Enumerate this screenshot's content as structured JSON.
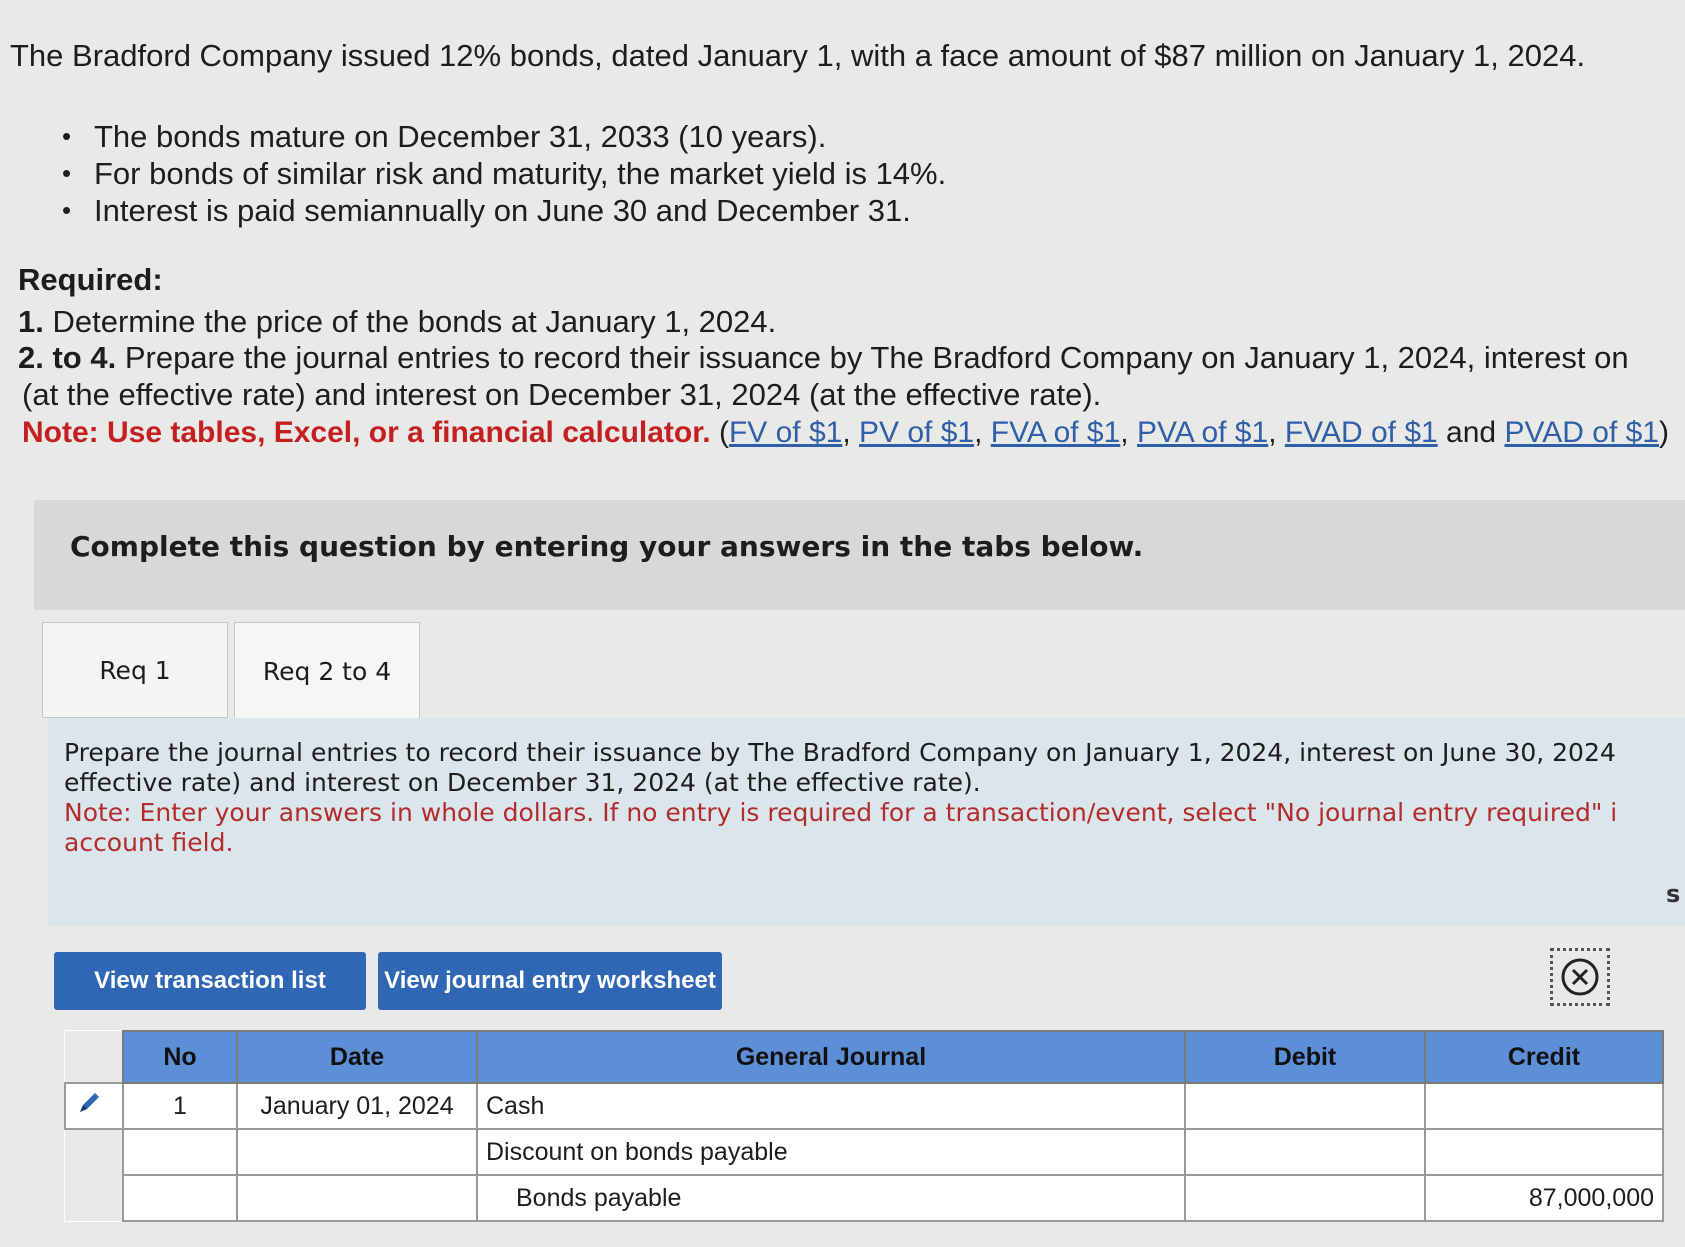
{
  "problem": {
    "intro": "The Bradford Company issued 12% bonds, dated January 1, with a face amount of $87 million on January 1, 2024.",
    "bullets": [
      "The bonds mature on December 31, 2033 (10 years).",
      "For bonds of similar risk and maturity, the market yield is 14%.",
      "Interest is paid semiannually on June 30 and December 31."
    ],
    "required_label": "Required:",
    "req1_num": "1.",
    "req1_text": "Determine the price of the bonds at January 1, 2024.",
    "req2_num": "2. to 4.",
    "req2_text": "Prepare the journal entries to record their issuance by The Bradford Company on January 1, 2024, interest on",
    "req2_cont": "(at the effective rate) and interest on December 31, 2024 (at the effective rate).",
    "note_label": "Note: Use tables, Excel, or a financial calculator.",
    "links": [
      "FV of $1",
      "PV of $1",
      "FVA of $1",
      "PVA of $1",
      "FVAD of $1",
      "PVAD of $1"
    ],
    "and_text": "and"
  },
  "instruction": "Complete this question by entering your answers in the tabs below.",
  "tabs": [
    {
      "label": "Req 1",
      "active": false
    },
    {
      "label": "Req 2 to 4",
      "active": true
    }
  ],
  "tab_content": {
    "line1": "Prepare the journal entries to record their issuance by The Bradford Company on January 1, 2024, interest on June 30, 2024",
    "line2": "effective rate) and interest on December 31, 2024 (at the effective rate).",
    "note1": "Note: Enter your answers in whole dollars. If no entry is required for a transaction/event, select \"No journal entry required\" i",
    "note2": "account field.",
    "edge_mark": "s"
  },
  "buttons": {
    "view_transactions": "View transaction list",
    "view_worksheet": "View journal entry worksheet"
  },
  "journal": {
    "headers": {
      "no": "No",
      "date": "Date",
      "general_journal": "General Journal",
      "debit": "Debit",
      "credit": "Credit"
    },
    "rows": [
      {
        "no": "1",
        "date": "January 01, 2024",
        "account": "Cash",
        "debit": "",
        "credit": "",
        "indent": false
      },
      {
        "no": "",
        "date": "",
        "account": "Discount on bonds payable",
        "debit": "",
        "credit": "",
        "indent": false
      },
      {
        "no": "",
        "date": "",
        "account": "Bonds payable",
        "debit": "",
        "credit": "87,000,000",
        "indent": true
      }
    ]
  },
  "colors": {
    "header_blue": "#5d8fd7",
    "button_blue": "#2f67b5",
    "note_red": "#c51f1f",
    "link_blue": "#2f5fa8"
  }
}
